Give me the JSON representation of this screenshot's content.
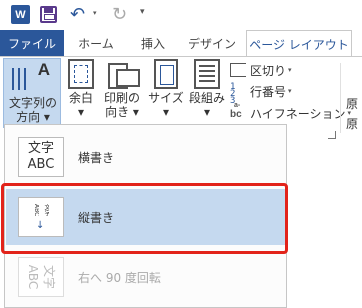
{
  "qat": {
    "app_logo_letter": "W",
    "icons": [
      "word-app-icon",
      "save-icon",
      "undo-icon",
      "redo-icon",
      "customize-qat-icon"
    ],
    "undo_glyph": "↶",
    "redo_glyph": "↻",
    "dropdown_glyph": "▾"
  },
  "tabs": {
    "file": "ファイル",
    "home": "ホーム",
    "insert": "挿入",
    "design": "デザイン",
    "page_layout": "ページ レイアウト",
    "active": "page_layout"
  },
  "ribbon": {
    "text_direction": "文字列の\n方向",
    "text_direction_line1": "文字列の",
    "text_direction_line2": "方向 ▾",
    "text_direction_A": "A",
    "margins_line1": "余白",
    "margins_line2": "▾",
    "orientation_line1": "印刷の",
    "orientation_line2": "向き ▾",
    "size_line1": "サイズ",
    "size_line2": "▾",
    "columns_line1": "段組み",
    "columns_line2": "▾",
    "breaks": "区切り",
    "line_numbers": "行番号",
    "hyphenation": "ハイフネーション",
    "hyphenation_icon": "bc",
    "hyphenation_sup": "a-",
    "cut_off_right_1": "原",
    "cut_off_right_2": "原",
    "dd": "▾"
  },
  "menu": {
    "items": [
      {
        "label": "横書き",
        "icon": "horizontal-text-icon",
        "icon_text_1": "文字",
        "icon_text_2": "ABC",
        "selected": false,
        "enabled": true
      },
      {
        "label": "縦書き",
        "icon": "vertical-text-icon",
        "icon_text_1": "文字",
        "icon_text_2": "ABC",
        "selected": true,
        "enabled": true
      },
      {
        "label": "右へ 90 度回転",
        "icon": "rotate-90-text-icon",
        "icon_text_1": "文字",
        "icon_text_2": "ABC",
        "selected": false,
        "enabled": false
      }
    ]
  },
  "colors": {
    "accent": "#2b579a",
    "selection": "#c5d9ef",
    "highlight_border": "#e2231a"
  }
}
